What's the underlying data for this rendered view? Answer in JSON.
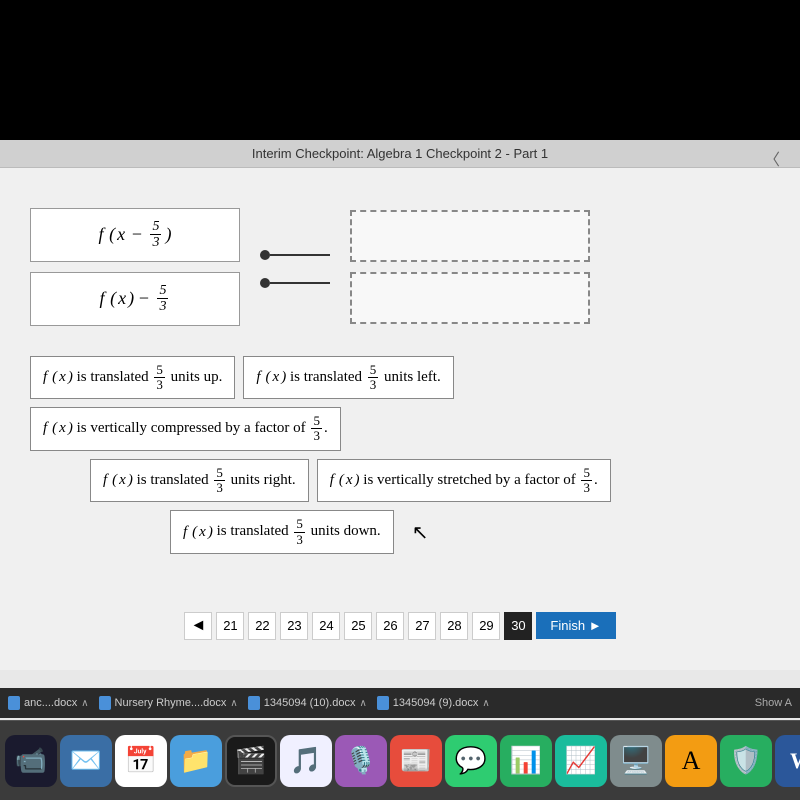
{
  "header": {
    "title": "Interim Checkpoint: Algebra 1 Checkpoint 2 - Part 1"
  },
  "matching": {
    "left_items": [
      {
        "id": "item1",
        "latex": "f(x − 5/3)"
      },
      {
        "id": "item2",
        "latex": "f(x) − 5/3"
      }
    ],
    "right_items": [
      {
        "id": "right1",
        "label": ""
      },
      {
        "id": "right2",
        "label": ""
      }
    ]
  },
  "choices": [
    {
      "id": "c1",
      "text": "f(x) is translated 5/3 units up."
    },
    {
      "id": "c2",
      "text": "f(x) is translated 5/3 units left."
    },
    {
      "id": "c3",
      "text": "f(x) is vertically compressed by a factor of 5/3."
    },
    {
      "id": "c4",
      "text": "f(x) is translated 5/3 units right."
    },
    {
      "id": "c5",
      "text": "f(x) is vertically stretched by a factor of 5/3."
    },
    {
      "id": "c6",
      "text": "f(x) is translated 5/3 units down."
    }
  ],
  "pagination": {
    "prev_label": "◄",
    "next_label": "►",
    "pages": [
      "21",
      "22",
      "23",
      "24",
      "25",
      "26",
      "27",
      "28",
      "29",
      "30"
    ],
    "active_page": "30",
    "finish_label": "Finish ►"
  },
  "taskbar": {
    "files": [
      {
        "name": "anc....docx"
      },
      {
        "name": "Nursery Rhyme....docx"
      },
      {
        "name": "1345094 (10).docx"
      },
      {
        "name": "1345094 (9).docx"
      }
    ],
    "show_more": "Show A"
  },
  "dock_icons": [
    "🎥",
    "📧",
    "🗓️",
    "📁",
    "🎬",
    "🎵",
    "🎙️",
    "📰",
    "💬",
    "📊",
    "📈",
    "🖥️",
    "📝"
  ]
}
